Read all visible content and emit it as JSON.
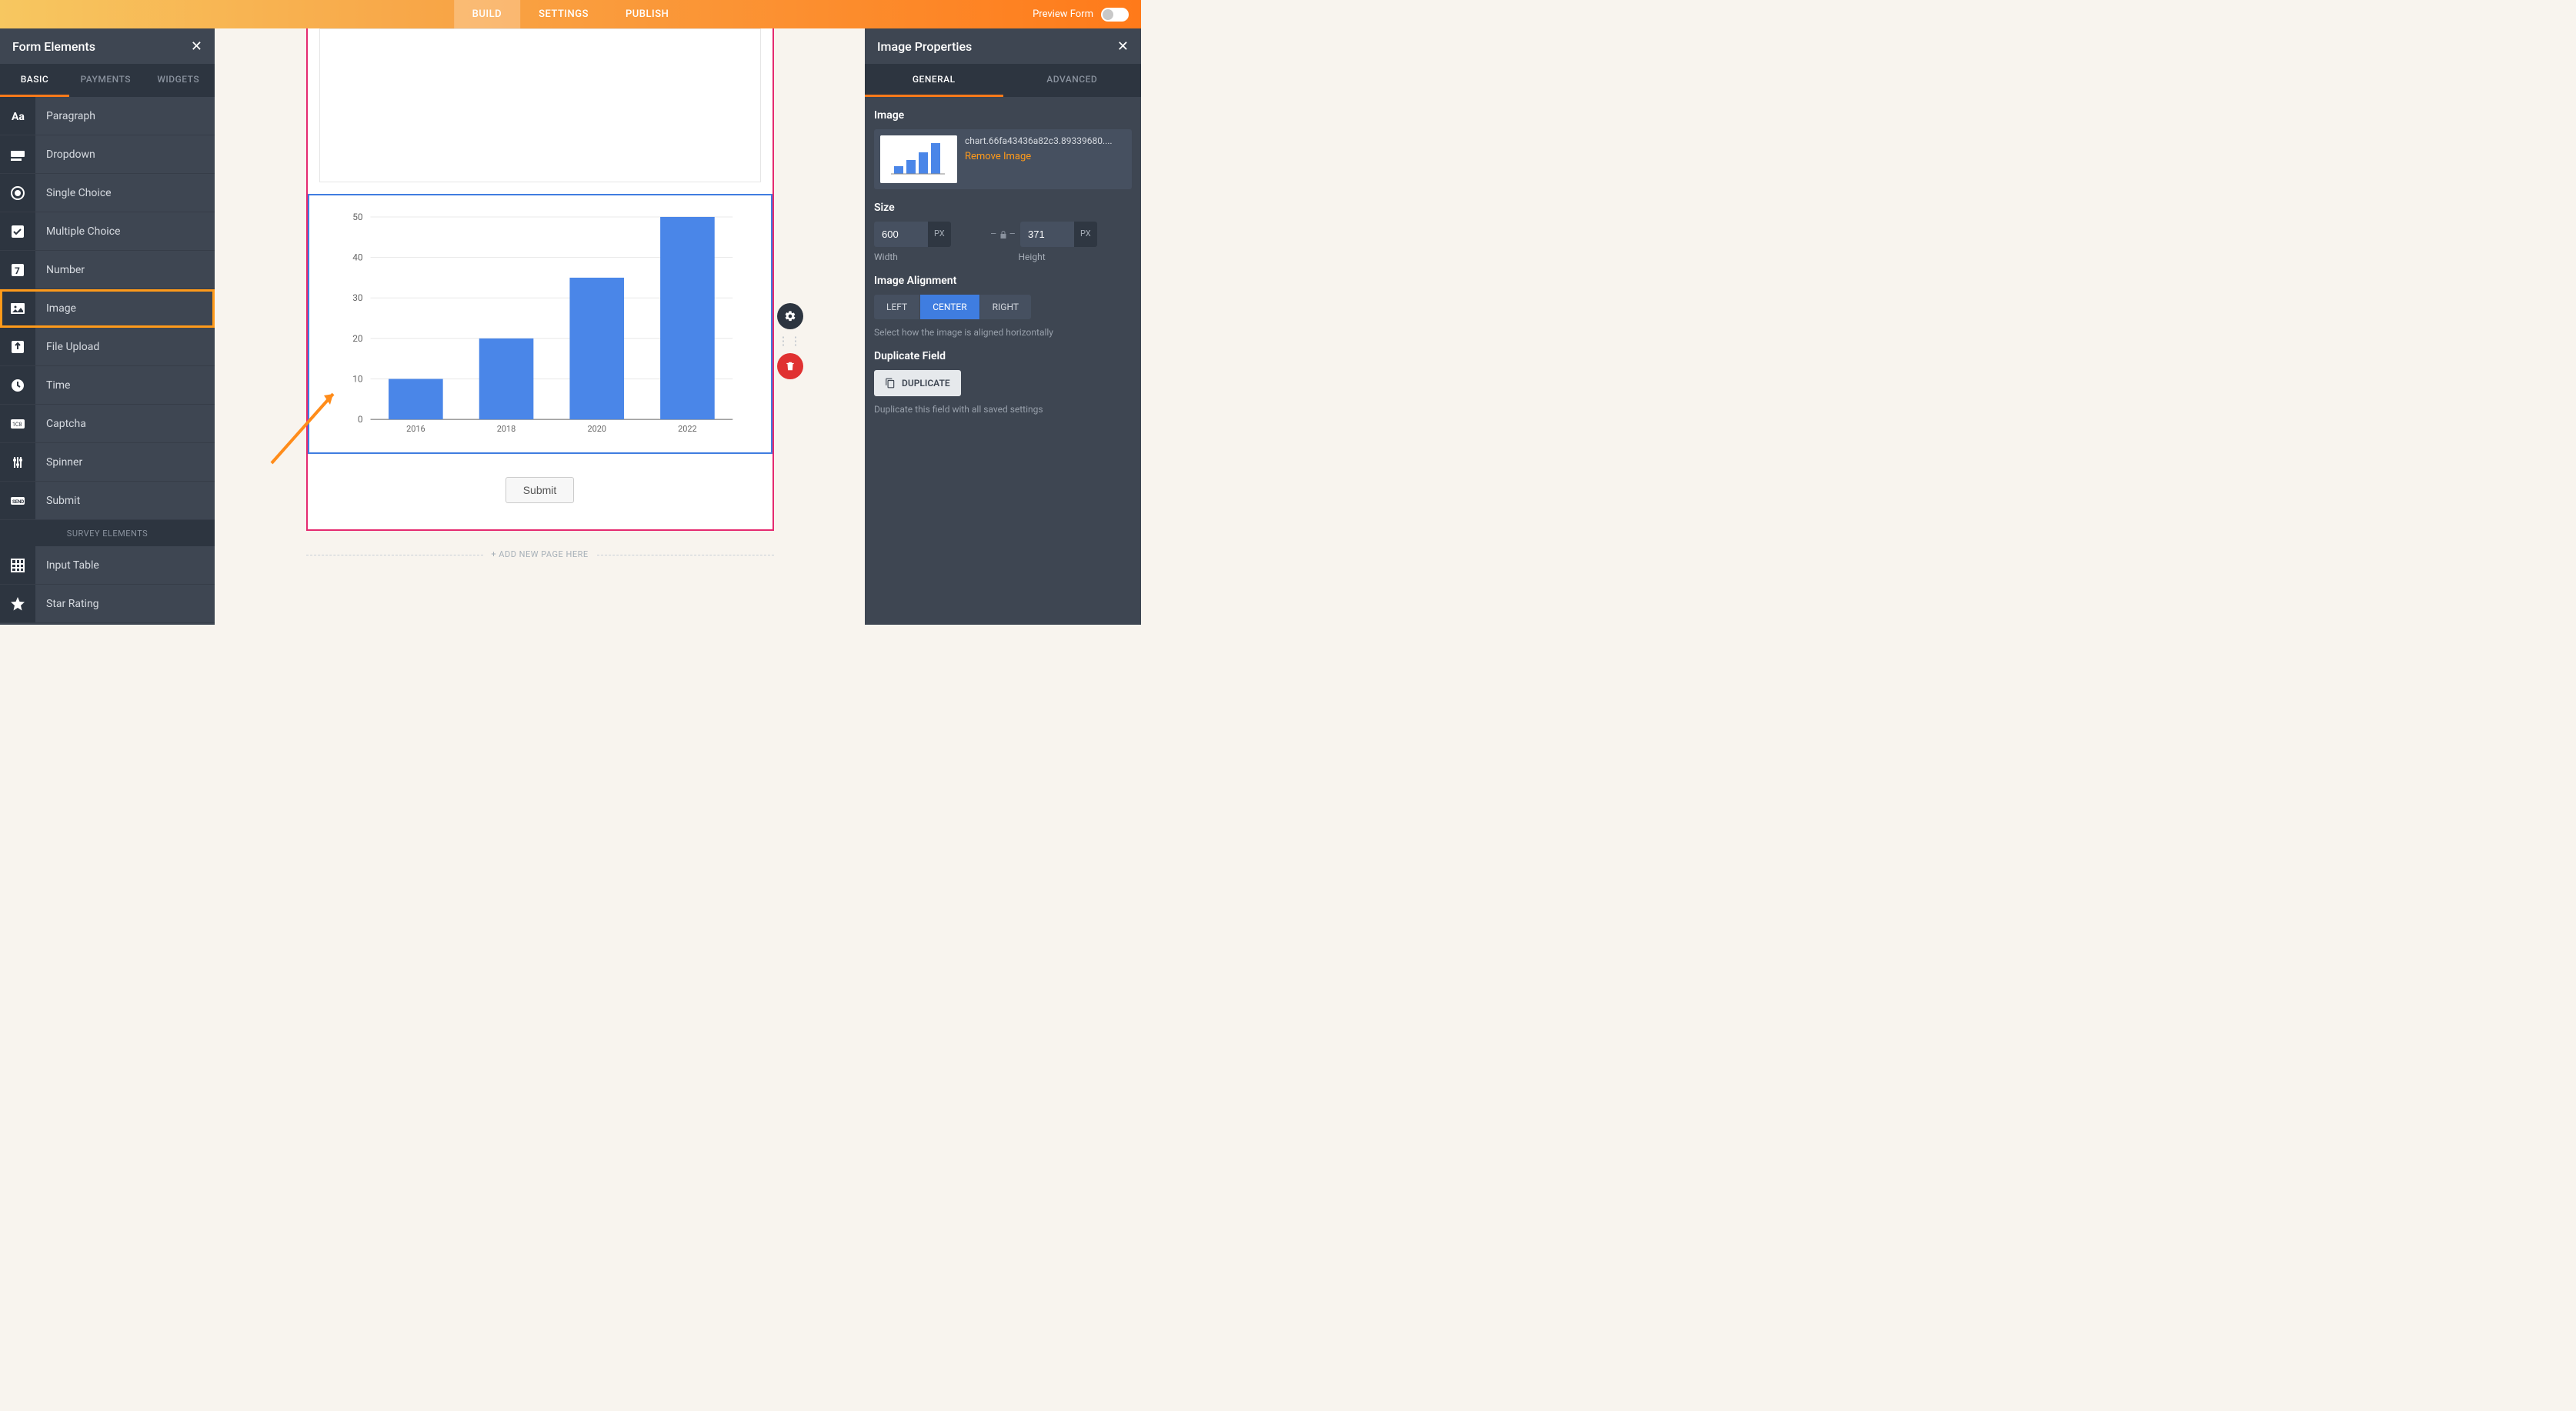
{
  "topbar": {
    "tabs": [
      {
        "label": "BUILD",
        "active": true
      },
      {
        "label": "SETTINGS",
        "active": false
      },
      {
        "label": "PUBLISH",
        "active": false
      }
    ],
    "preview_label": "Preview Form"
  },
  "left_panel": {
    "title": "Form Elements",
    "tabs": [
      {
        "label": "BASIC",
        "active": true
      },
      {
        "label": "PAYMENTS",
        "active": false
      },
      {
        "label": "WIDGETS",
        "active": false
      }
    ],
    "elements": [
      {
        "icon": "paragraph",
        "label": "Paragraph"
      },
      {
        "icon": "dropdown",
        "label": "Dropdown"
      },
      {
        "icon": "radio",
        "label": "Single Choice"
      },
      {
        "icon": "checkbox",
        "label": "Multiple Choice"
      },
      {
        "icon": "number",
        "label": "Number"
      },
      {
        "icon": "image",
        "label": "Image",
        "highlighted": true
      },
      {
        "icon": "upload",
        "label": "File Upload"
      },
      {
        "icon": "time",
        "label": "Time"
      },
      {
        "icon": "captcha",
        "label": "Captcha"
      },
      {
        "icon": "spinner",
        "label": "Spinner"
      },
      {
        "icon": "submit",
        "label": "Submit"
      }
    ],
    "survey_header": "SURVEY ELEMENTS",
    "survey_elements": [
      {
        "icon": "table",
        "label": "Input Table"
      },
      {
        "icon": "star",
        "label": "Star Rating"
      }
    ]
  },
  "center": {
    "submit_label": "Submit",
    "add_page_label": "+ ADD NEW PAGE HERE"
  },
  "chart_data": {
    "type": "bar",
    "categories": [
      "2016",
      "2018",
      "2020",
      "2022"
    ],
    "values": [
      10,
      20,
      35,
      50
    ],
    "y_ticks": [
      0,
      10,
      20,
      30,
      40,
      50
    ],
    "ylim": [
      0,
      50
    ],
    "bar_color": "#4a86e8"
  },
  "right_panel": {
    "title": "Image Properties",
    "tabs": [
      {
        "label": "GENERAL",
        "active": true
      },
      {
        "label": "ADVANCED",
        "active": false
      }
    ],
    "image_section": {
      "label": "Image",
      "filename": "chart.66fa43436a82c3.89339680....",
      "remove_label": "Remove Image"
    },
    "size_section": {
      "label": "Size",
      "width": "600",
      "height": "371",
      "unit": "PX",
      "width_label": "Width",
      "height_label": "Height"
    },
    "alignment_section": {
      "label": "Image Alignment",
      "options": [
        {
          "label": "LEFT",
          "active": false
        },
        {
          "label": "CENTER",
          "active": true
        },
        {
          "label": "RIGHT",
          "active": false
        }
      ],
      "help": "Select how the image is aligned horizontally"
    },
    "duplicate_section": {
      "label": "Duplicate Field",
      "button": "DUPLICATE",
      "help": "Duplicate this field with all saved settings"
    }
  }
}
